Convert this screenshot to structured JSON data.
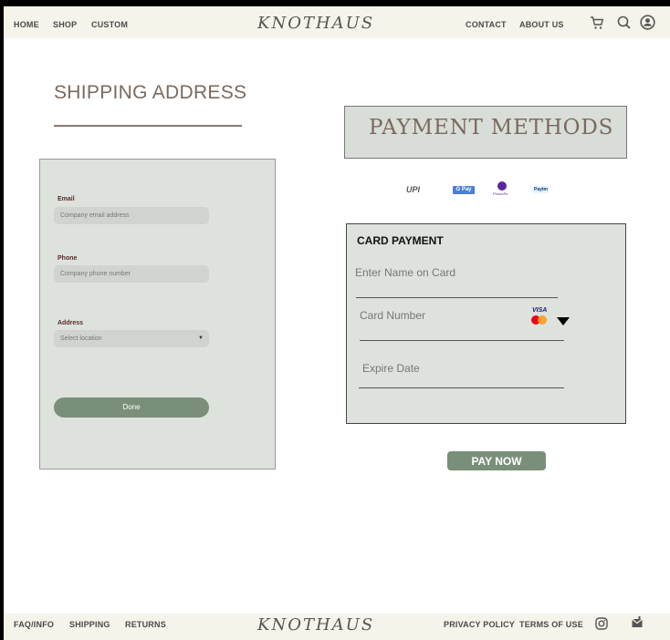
{
  "nav": {
    "home": "HOME",
    "shop": "SHOP",
    "custom": "CUSTOM",
    "brand": "KNOTHAUS",
    "contact": "CONTACT",
    "about": "ABOUT US"
  },
  "shipping": {
    "title": "SHIPPING ADDRESS",
    "email_label": "Email",
    "email_placeholder": "Company email address",
    "phone_label": "Phone",
    "phone_placeholder": "Company phone number",
    "address_label": "Address",
    "address_select": "Select location",
    "done": "Done"
  },
  "payment": {
    "title": "PAYMENT  METHODS",
    "logos": [
      "UPI",
      "G Pay",
      "PhonePe",
      "Paytm"
    ],
    "card_heading": "CARD PAYMENT",
    "name_placeholder": "Enter Name on Card",
    "number_placeholder": "Card Number",
    "card_brands": [
      "VISA",
      "MasterCard"
    ],
    "expiry_placeholder": "Expire Date",
    "pay_now": "PAY NOW"
  },
  "footer": {
    "faq": "FAQ/INFO",
    "shipping": "SHIPPING",
    "returns": "RETURNS",
    "brand": "KNOTHAUS",
    "privacy": "PRIVACY POLICY",
    "terms": "TERMS OF USE"
  },
  "colors": {
    "nav_bg": "#f6f3ea",
    "panel_bg": "#dde2dc",
    "button": "#7a8f7a",
    "title": "#7a6a5e"
  }
}
